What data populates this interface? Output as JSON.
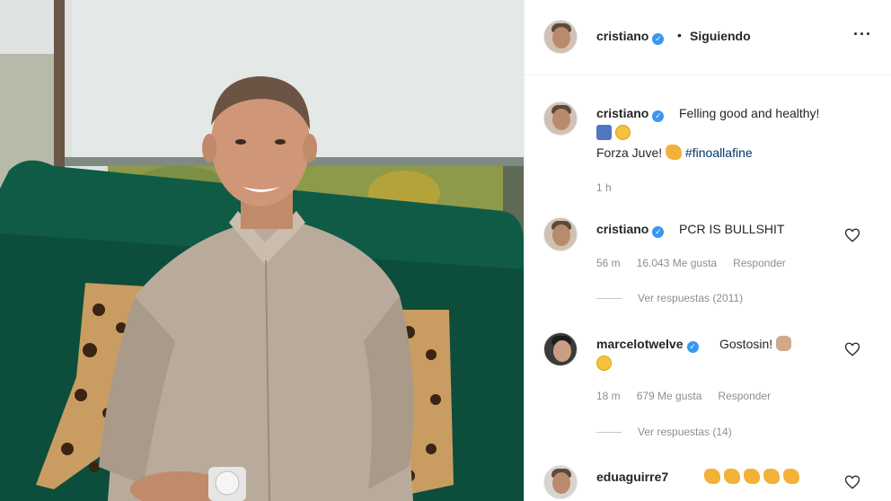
{
  "post_header": {
    "username": "cristiano",
    "separator": "•",
    "follow_status": "Siguiendo",
    "more_icon": "more-options-icon"
  },
  "caption": {
    "username": "cristiano",
    "text_line1": "Felling good and healthy!",
    "text_line3": "Forza Juve!",
    "hashtag": "#finoallafine",
    "time": "1 h"
  },
  "comments": [
    {
      "username": "cristiano",
      "text": "PCR IS BULLSHIT",
      "time": "56 m",
      "likes": "16.043 Me gusta",
      "reply": "Responder",
      "view_replies": "Ver respuestas (2011)"
    },
    {
      "username": "marcelotwelve",
      "text": "Gostosin!",
      "time": "18 m",
      "likes": "679 Me gusta",
      "reply": "Responder",
      "view_replies": "Ver respuestas (14)"
    },
    {
      "username": "eduaguirre7",
      "text": ""
    }
  ],
  "colors": {
    "verified": "#3897f0",
    "hashtag": "#00376b",
    "meta": "#8e8e8e"
  }
}
